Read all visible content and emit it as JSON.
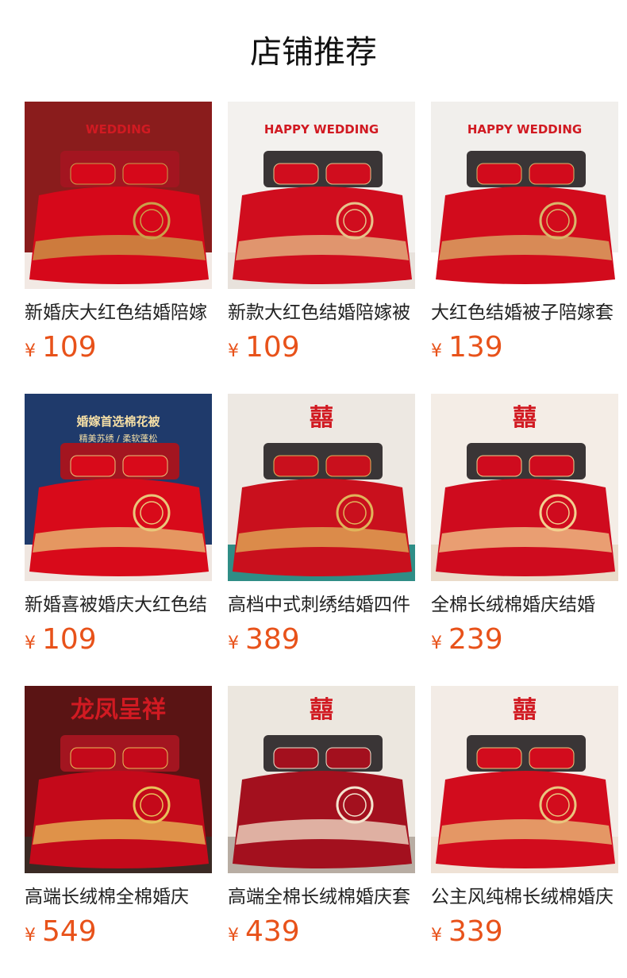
{
  "header": {
    "title": "店铺推荐"
  },
  "currency_symbol": "¥",
  "products": [
    {
      "name": "新婚庆大红色结婚陪嫁",
      "price": "109",
      "image_icon": "red-bedding-photo-icon",
      "image_text": "WEDDING",
      "colors": {
        "wall": "#8a1c1c",
        "bed": "#d6081a",
        "accent": "#c9a14a",
        "floor": "#f2e9e4"
      }
    },
    {
      "name": "新款大红色结婚陪嫁被",
      "price": "109",
      "image_icon": "red-bedding-photo-icon",
      "image_text": "HAPPY WEDDING",
      "colors": {
        "wall": "#f3f1ee",
        "bed": "#d00d1e",
        "accent": "#e6c38a",
        "floor": "#e8e2dc"
      }
    },
    {
      "name": "大红色结婚被子陪嫁套",
      "price": "139",
      "image_icon": "red-bedding-photo-icon",
      "image_text": "HAPPY WEDDING",
      "colors": {
        "wall": "#f1efec",
        "bed": "#d20b1c",
        "accent": "#d9b66a",
        "floor": "#ffffff"
      }
    },
    {
      "name": "新婚喜被婚庆大红色结",
      "price": "109",
      "image_icon": "red-bedding-photo-icon",
      "image_text": "婚嫁首选棉花被",
      "image_subtext": "精美苏绣 / 柔软蓬松",
      "colors": {
        "wall": "#1f3a6b",
        "bed": "#d80a1a",
        "accent": "#e9c77a",
        "floor": "#efe6e0"
      }
    },
    {
      "name": "高档中式刺绣结婚四件",
      "price": "389",
      "image_icon": "red-bedding-photo-icon",
      "image_text": "囍",
      "colors": {
        "wall": "#ede8e2",
        "bed": "#c9101d",
        "accent": "#e0b45a",
        "floor": "#2f8d86"
      }
    },
    {
      "name": "全棉长绒棉婚庆结婚",
      "price": "239",
      "image_icon": "red-bedding-photo-icon",
      "image_text": "囍",
      "colors": {
        "wall": "#f4ede6",
        "bed": "#cf0b1e",
        "accent": "#f2d08f",
        "floor": "#eadbc9"
      }
    },
    {
      "name": "高端长绒棉全棉婚庆",
      "price": "549",
      "image_icon": "red-bedding-photo-icon",
      "image_text": "龙凤呈祥",
      "colors": {
        "wall": "#5a1414",
        "bed": "#c4091a",
        "accent": "#e8c05a",
        "floor": "#3a2a24"
      }
    },
    {
      "name": "高端全棉长绒棉婚庆套",
      "price": "439",
      "image_icon": "red-bedding-photo-icon",
      "image_text": "囍",
      "colors": {
        "wall": "#ece7df",
        "bed": "#a3101e",
        "accent": "#f3e5cf",
        "floor": "#b8ada3"
      }
    },
    {
      "name": "公主风纯棉长绒棉婚庆",
      "price": "339",
      "image_icon": "red-bedding-photo-icon",
      "image_text": "囍",
      "colors": {
        "wall": "#f3ece6",
        "bed": "#d20c1d",
        "accent": "#e9c67e",
        "floor": "#efe2d6"
      }
    }
  ]
}
